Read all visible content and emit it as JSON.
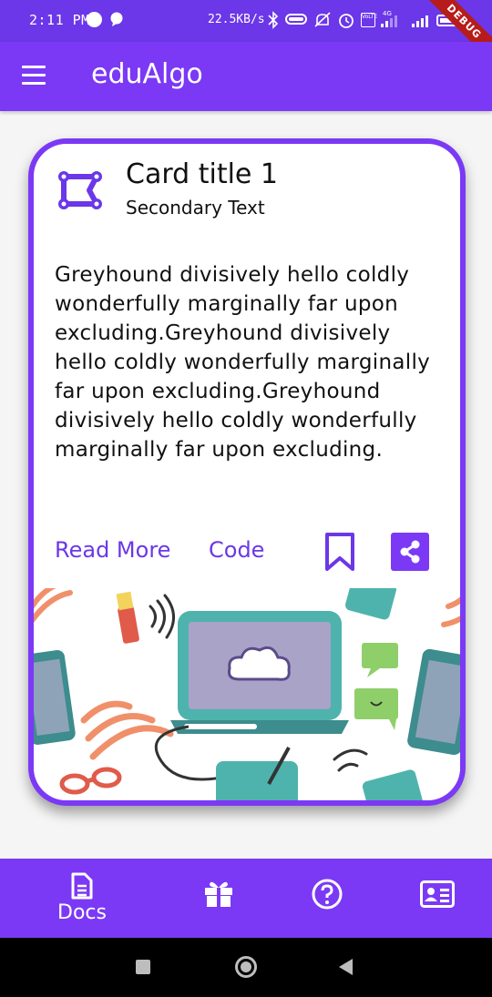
{
  "status_bar": {
    "time": "2:11 PM",
    "network_speed": "22.5KB/s",
    "network_type": "4G",
    "debug_banner": "DEBUG",
    "icons": [
      "messenger-icon",
      "chat-icon",
      "bluetooth-icon",
      "battery-saver-icon",
      "mute-icon",
      "alarm-icon",
      "volte-icon",
      "signal-icon",
      "battery-icon"
    ]
  },
  "app_bar": {
    "title": "eduAlgo",
    "menu_icon": "hamburger-menu-icon"
  },
  "card": {
    "title": "Card title 1",
    "subtitle": "Secondary Text",
    "body": "Greyhound divisively hello coldly wonderfully marginally far upon excluding.Greyhound divisively hello coldly wonderfully marginally far upon excluding.Greyhound divisively hello coldly wonderfully marginally far upon excluding.",
    "read_more_label": "Read More",
    "code_label": "Code",
    "leading_icon": "vector-square-icon",
    "bookmark_icon": "bookmark-icon",
    "share_icon": "share-icon",
    "image": "illustration of laptop, tablet, phones, chat bubbles and wifi signals"
  },
  "bottom_nav": {
    "items": [
      {
        "label": "Docs",
        "icon": "document-icon",
        "active": true
      },
      {
        "label": "",
        "icon": "gift-icon",
        "active": false
      },
      {
        "label": "",
        "icon": "help-circle-icon",
        "active": false
      },
      {
        "label": "",
        "icon": "id-card-icon",
        "active": false
      }
    ]
  },
  "colors": {
    "primary": "#7b39f5",
    "status_bar": "#6b37e8",
    "background": "#f5f5f5",
    "card_border": "#7b39f5",
    "link": "#6b37e8",
    "debug": "#b71c1c"
  }
}
